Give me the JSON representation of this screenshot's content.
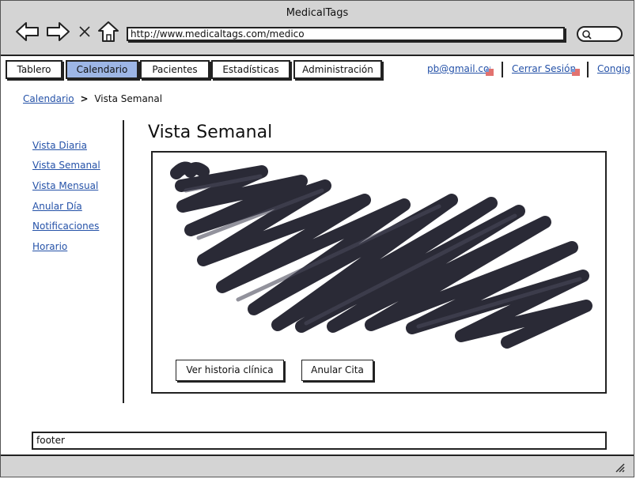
{
  "window": {
    "title": "MedicalTags"
  },
  "browser": {
    "url": "http://www.medicaltags.com/medico"
  },
  "tabs": [
    {
      "label": "Tablero",
      "active": false
    },
    {
      "label": "Calendario",
      "active": true
    },
    {
      "label": "Pacientes",
      "active": false
    },
    {
      "label": "Estadísticas",
      "active": false
    },
    {
      "label": "Administración",
      "active": false
    }
  ],
  "toplinks": {
    "email": "pb@gmail.com",
    "logout": "Cerrar Sesión",
    "config": "Congig"
  },
  "breadcrumb": {
    "parent": "Calendario",
    "separator": ">",
    "current": "Vista Semanal"
  },
  "sidebar": {
    "items": [
      {
        "label": "Vista Diaria"
      },
      {
        "label": "Vista Semanal"
      },
      {
        "label": "Vista Mensual"
      },
      {
        "label": "Anular Día"
      },
      {
        "label": "Notificaciones"
      },
      {
        "label": "Horario"
      }
    ]
  },
  "main": {
    "title": "Vista Semanal",
    "buttons": {
      "history": "Ver historia clínica",
      "cancel": "Anular Cita"
    }
  },
  "footer": {
    "text": "footer"
  },
  "colors": {
    "active_tab": "#9db6e6",
    "link": "#2552a8",
    "chrome": "#d4d4d4"
  }
}
